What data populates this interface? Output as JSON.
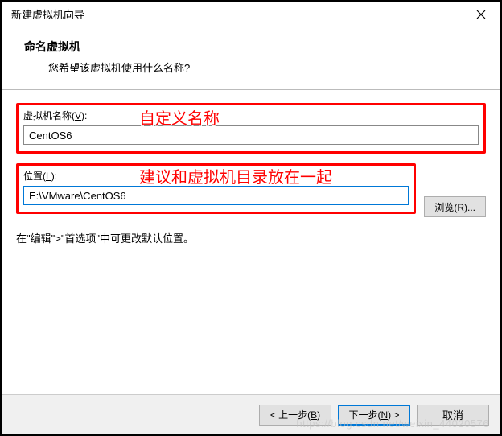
{
  "window": {
    "title": "新建虚拟机向导"
  },
  "header": {
    "title": "命名虚拟机",
    "subtitle": "您希望该虚拟机使用什么名称?"
  },
  "fields": {
    "name": {
      "label_prefix": "虚拟机名称(",
      "label_key": "V",
      "label_suffix": "):",
      "value": "CentOS6",
      "annotation": "自定义名称"
    },
    "location": {
      "label_prefix": "位置(",
      "label_key": "L",
      "label_suffix": "):",
      "value": "E:\\VMware\\CentOS6",
      "annotation": "建议和虚拟机目录放在一起",
      "browse_prefix": "浏览(",
      "browse_key": "R",
      "browse_suffix": ")..."
    }
  },
  "hint": "在\"编辑\">\"首选项\"中可更改默认位置。",
  "footer": {
    "back_prefix": "< 上一步(",
    "back_key": "B",
    "back_suffix": ")",
    "next_prefix": "下一步(",
    "next_key": "N",
    "next_suffix": ") >",
    "cancel": "取消"
  },
  "watermark": "https://blog.csdn.net/weixin_44020576"
}
